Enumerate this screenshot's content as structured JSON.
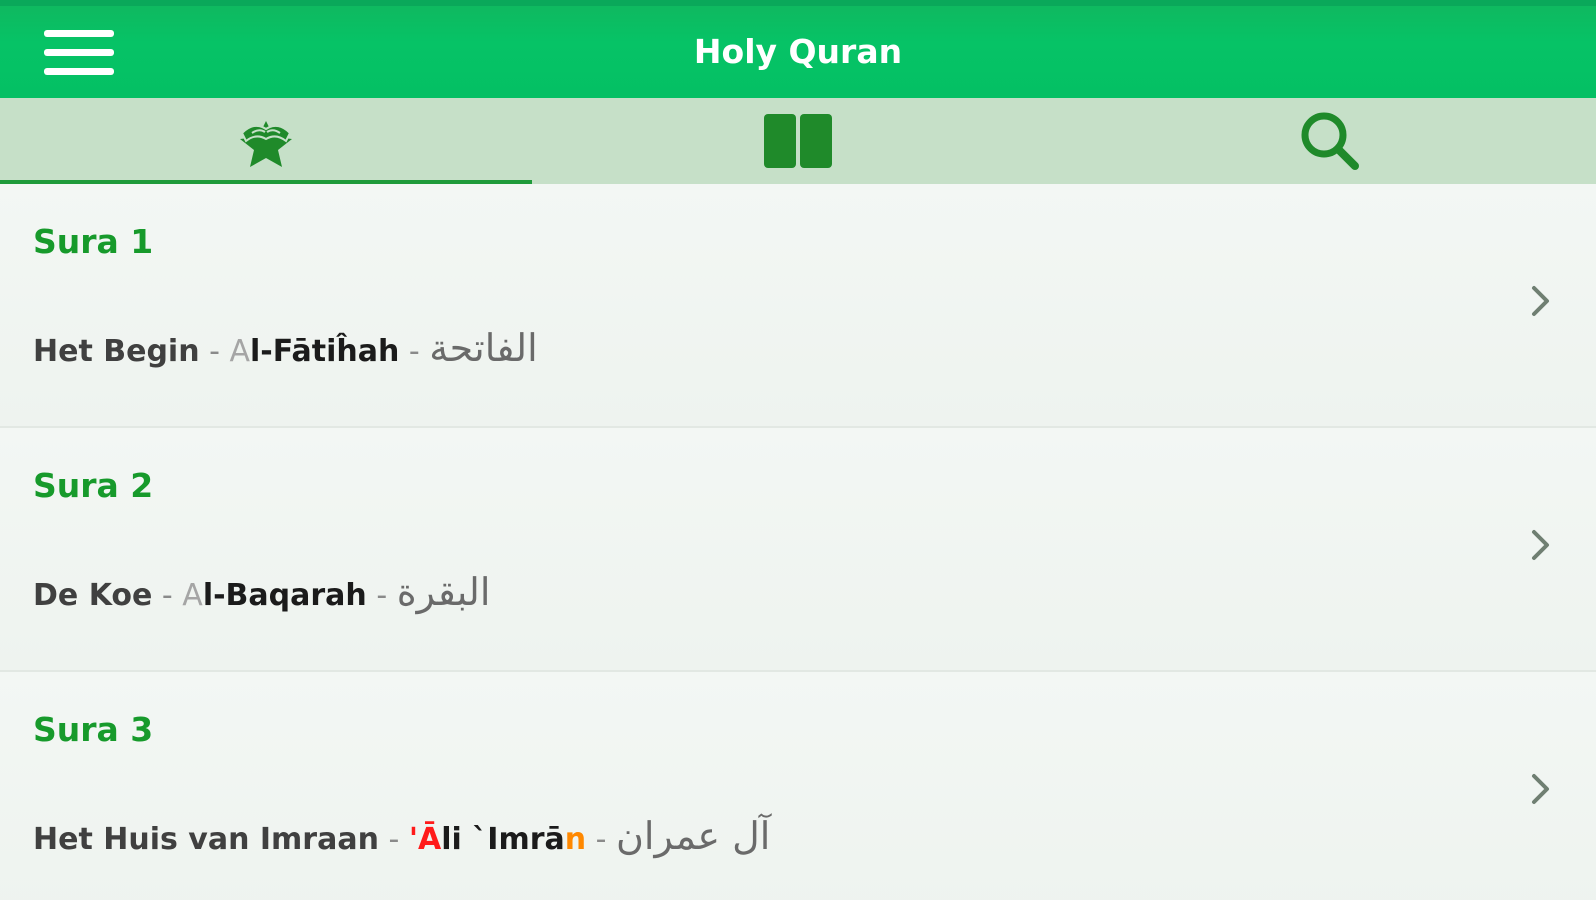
{
  "header": {
    "title": "Holy Quran",
    "menu_icon": "hamburger-menu-icon"
  },
  "tabs": [
    {
      "icon": "quran-star-icon",
      "active": true
    },
    {
      "icon": "book-columns-icon",
      "active": false
    },
    {
      "icon": "search-icon",
      "active": false
    }
  ],
  "colors": {
    "header_green": "#06c366",
    "tabbar_bg": "#c6e0c8",
    "tab_icon": "#1f8a2a",
    "title_green": "#179a2b",
    "highlight_red": "#ff1a1a",
    "highlight_orange": "#ff8800"
  },
  "suras": [
    {
      "title": "Sura 1",
      "translation": "Het Begin",
      "sep1": " - ",
      "latin_prefix": "A",
      "latin_main": "l-Fātiĥah",
      "sep2": " - ",
      "arabic": "الفاتحة"
    },
    {
      "title": "Sura 2",
      "translation": "De Koe",
      "sep1": " - ",
      "latin_prefix": "A",
      "latin_main": "l-Baqarah",
      "sep2": " - ",
      "arabic": "البقرة"
    },
    {
      "title": "Sura 3",
      "translation": "Het Huis van Imraan",
      "sep1": " - ",
      "latin_red": "'Ā",
      "latin_main": "li `Imrā",
      "latin_orange": "n",
      "sep2": " - ",
      "arabic": "آل عمران"
    }
  ]
}
